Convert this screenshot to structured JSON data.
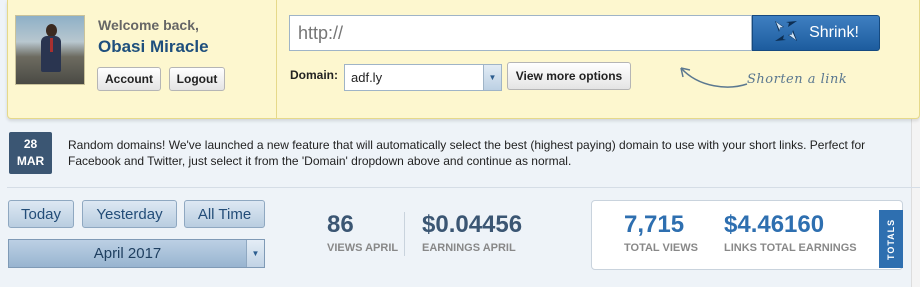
{
  "user": {
    "welcome": "Welcome back,",
    "name": "Obasi Miracle",
    "account_label": "Account",
    "logout_label": "Logout"
  },
  "shrink": {
    "url_placeholder": "http://",
    "button_label": "Shrink!",
    "domain_label": "Domain:",
    "domain_value": "adf.ly",
    "more_options_label": "View more options",
    "hint": "Shorten a link"
  },
  "announcement": {
    "day": "28",
    "month": "MAR",
    "text": "Random domains! We've launched a new feature that will automatically select the best (highest paying) domain to use with your short links. Perfect for Facebook and Twitter, just select it from the 'Domain' dropdown above and continue as normal."
  },
  "range": {
    "today": "Today",
    "yesterday": "Yesterday",
    "alltime": "All Time",
    "month_selected": "April 2017"
  },
  "stats": {
    "views_value": "86",
    "views_label": "VIEWS APRIL",
    "earnings_value": "$0.04456",
    "earnings_label": "EARNINGS APRIL"
  },
  "totals": {
    "views_value": "7,715",
    "views_label": "TOTAL VIEWS",
    "earnings_value": "$4.46160",
    "earnings_label": "LINKS TOTAL EARNINGS",
    "tab_label": "TOTALS"
  },
  "colors": {
    "panel_yellow": "#fdf7cf",
    "brand_blue": "#1d5c9e",
    "stat_dark": "#3b5673",
    "stat_blue": "#2e6fb0"
  }
}
